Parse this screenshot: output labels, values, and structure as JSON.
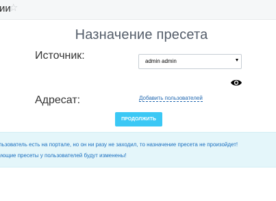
{
  "header": {
    "title_fragment": "ии",
    "star_icon": "star-icon"
  },
  "dialog": {
    "title": "Назначение пресета",
    "source_label": "Источник:",
    "source_value": "admin admin",
    "target_label": "Адресат:",
    "add_users_link": "Добавить пользователей",
    "eye_icon": "eye-icon",
    "continue_button": "ПРОДОЛЖИТЬ"
  },
  "notice": {
    "line1": "льзователь есть на портале, но он ни разу не заходил, то назначение пресета не произойдет!",
    "line2": "ующие пресеты у пользователей будут изменены!",
    "color": "#e4f6fa"
  },
  "colors": {
    "accent_button": "#3bc8f5",
    "link": "#2067b0"
  }
}
